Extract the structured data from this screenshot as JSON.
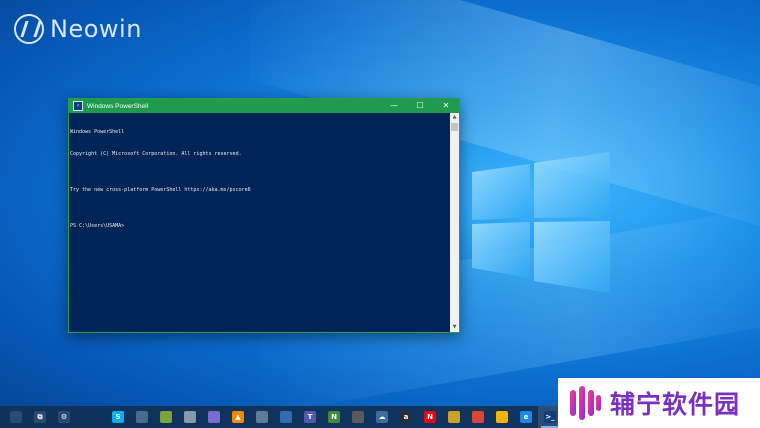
{
  "watermark": {
    "brand": "Neowin"
  },
  "window": {
    "title": "Windows PowerShell",
    "controls": {
      "minimize": "—",
      "maximize": "☐",
      "close": "✕"
    },
    "console_lines": [
      "Windows PowerShell",
      "Copyright (C) Microsoft Corporation. All rights reserved.",
      "",
      "Try the new cross-platform PowerShell https://aka.ms/pscore6",
      "",
      "PS C:\\Users\\USAMA>"
    ]
  },
  "taskbar": {
    "items": [
      {
        "name": "cortana-search-icon",
        "glyph": "",
        "color": "#2a4a70"
      },
      {
        "name": "task-view-icon",
        "glyph": "⧉",
        "color": "#2a4a70"
      },
      {
        "name": "settings-gear-icon",
        "glyph": "⚙",
        "color": "#2a4a70"
      },
      {
        "name": "skype-icon",
        "glyph": "S",
        "color": "#00aff0"
      },
      {
        "name": "app-icon-b",
        "glyph": "",
        "color": "#4b6b8c"
      },
      {
        "name": "app-icon-c",
        "glyph": "",
        "color": "#7aa33a"
      },
      {
        "name": "storage-icon",
        "glyph": "",
        "color": "#8899aa"
      },
      {
        "name": "app-icon-e",
        "glyph": "",
        "color": "#7a6bd0"
      },
      {
        "name": "vlc-icon",
        "glyph": "▲",
        "color": "#f08a00"
      },
      {
        "name": "app-icon-g",
        "glyph": "",
        "color": "#5b7d9a"
      },
      {
        "name": "photos-icon",
        "glyph": "",
        "color": "#2f6db0"
      },
      {
        "name": "teams-icon",
        "glyph": "T",
        "color": "#5558af"
      },
      {
        "name": "onenote-icon",
        "glyph": "N",
        "color": "#3f8a3f"
      },
      {
        "name": "calculator-icon",
        "glyph": "",
        "color": "#5a5a5a"
      },
      {
        "name": "weather-icon",
        "glyph": "☁",
        "color": "#3a6fa0"
      },
      {
        "name": "amazon-icon",
        "glyph": "a",
        "color": "#232f3e"
      },
      {
        "name": "netflix-icon",
        "glyph": "N",
        "color": "#e50914"
      },
      {
        "name": "app-icon-r",
        "glyph": "",
        "color": "#c9a227"
      },
      {
        "name": "chrome-icon",
        "glyph": "",
        "color": "#db4437"
      },
      {
        "name": "chrome-canary-icon",
        "glyph": "",
        "color": "#f4b400"
      },
      {
        "name": "edge-icon",
        "glyph": "e",
        "color": "#1e88e5"
      },
      {
        "name": "powershell-taskbar-icon",
        "glyph": ">_",
        "color": "#0e3f7a"
      }
    ]
  },
  "badge": {
    "text": "辅宁软件园"
  }
}
